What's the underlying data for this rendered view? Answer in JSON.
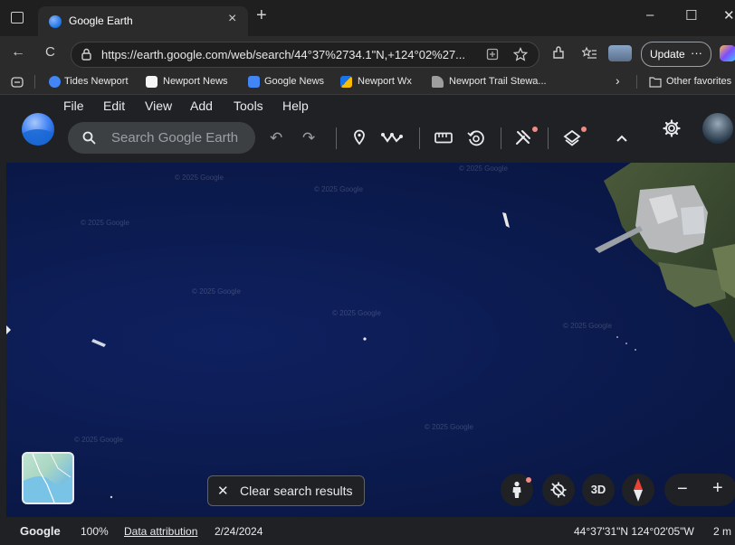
{
  "browser": {
    "tab_title": "Google Earth",
    "tab_close": "×",
    "new_tab": "+",
    "minimize": "–",
    "maximize": "☐",
    "close": "✕",
    "back": "←",
    "reload": "C",
    "url": "https://earth.google.com/web/search/44°37%2734.1\"N,+124°02%27...",
    "update_label": "Update",
    "more": "···",
    "chevron": "›",
    "bookmarks": [
      {
        "label": "Tides Newport",
        "color": "#4285f4"
      },
      {
        "label": "Newport News",
        "color": "#ffffff"
      },
      {
        "label": "Google News",
        "color": "#4285f4"
      },
      {
        "label": "Newport Wx",
        "color": "#fbbc04"
      },
      {
        "label": "Newport Trail Stewa...",
        "color": "#9e9e9e"
      }
    ],
    "other_favorites": "Other favorites"
  },
  "app": {
    "menu": [
      "File",
      "Edit",
      "View",
      "Add",
      "Tools",
      "Help"
    ],
    "search_placeholder": "Search Google Earth",
    "tools": {
      "undo": "↶",
      "redo": "↷",
      "placemark": "⌖",
      "path": "〰",
      "measure": "▭",
      "history": "⟲",
      "projects": "✂",
      "layers": "◈",
      "collapse": "⌃",
      "settings": "⚙"
    }
  },
  "map": {
    "watermarks": [
      "© 2025 Google",
      "© 2025 Google",
      "© 2025 Google",
      "© 2025 Google",
      "© 2025 Google",
      "© 2025 Google",
      "© 2025 Google",
      "© 2025 Google",
      "© 2025 Google"
    ],
    "clear_x": "✕",
    "clear_label": "Clear search results",
    "btn_3d": "3D",
    "zoom_out": "−",
    "zoom_in": "+"
  },
  "status": {
    "brand": "Google",
    "zoom": "100%",
    "attribution": "Data attribution",
    "date": "2/24/2024",
    "coords": "44°37'31\"N 124°02'05\"W",
    "scale": "2 m"
  }
}
